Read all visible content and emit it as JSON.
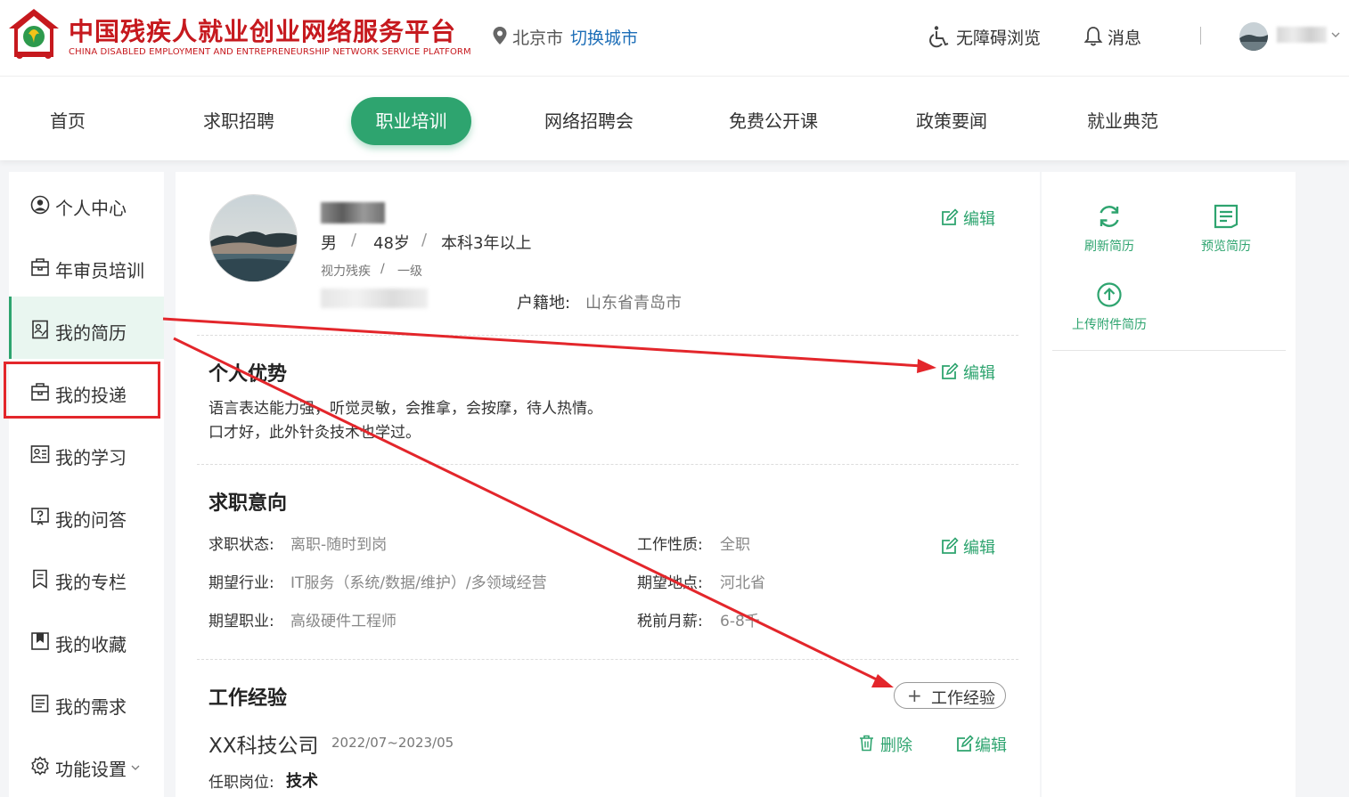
{
  "header": {
    "brand_cn": "中国残疾人就业创业网络服务平台",
    "brand_en": "CHINA DISABLED EMPLOYMENT AND ENTREPRENEURSHIP NETWORK SERVICE PLATFORM",
    "city": "北京市",
    "switch_city": "切换城市",
    "accessibility": "无障碍浏览",
    "messages": "消息",
    "icons": [
      "logo-icon",
      "location-pin-icon",
      "accessibility-icon",
      "bell-icon",
      "chevron-down-icon"
    ]
  },
  "nav": {
    "items": [
      "首页",
      "求职招聘",
      "职业培训",
      "网络招聘会",
      "免费公开课",
      "政策要闻",
      "就业典范"
    ],
    "active": "职业培训"
  },
  "sidebar": {
    "items": [
      {
        "label": "个人中心",
        "icon": "user-circle-icon"
      },
      {
        "label": "年审员培训",
        "icon": "briefcase-icon"
      },
      {
        "label": "我的简历",
        "icon": "resume-icon"
      },
      {
        "label": "我的投递",
        "icon": "briefcase-icon"
      },
      {
        "label": "我的学习",
        "icon": "study-icon"
      },
      {
        "label": "我的问答",
        "icon": "question-icon"
      },
      {
        "label": "我的专栏",
        "icon": "column-icon"
      },
      {
        "label": "我的收藏",
        "icon": "bookmark-icon"
      },
      {
        "label": "我的需求",
        "icon": "list-icon"
      },
      {
        "label": "功能设置",
        "icon": "gear-icon"
      }
    ],
    "active": "我的简历",
    "highlighted": "我的投递"
  },
  "profile": {
    "gender": "男",
    "age": "48岁",
    "experience": "本科3年以上",
    "disability_type": "视力残疾",
    "disability_level": "一级",
    "hukou_label": "户籍地:",
    "hukou_value": "山东省青岛市",
    "edit_label": "编辑"
  },
  "advantages": {
    "title": "个人优势",
    "edit_label": "编辑",
    "lines": [
      "语言表达能力强，听觉灵敏，会推拿，会按摩，待人热情。",
      "口才好，此外针灸技术也学过。"
    ]
  },
  "intention": {
    "title": "求职意向",
    "edit_label": "编辑",
    "fields": [
      {
        "label": "求职状态:",
        "value": "离职-随时到岗"
      },
      {
        "label": "工作性质:",
        "value": "全职"
      },
      {
        "label": "期望行业:",
        "value": "IT服务（系统/数据/维护）/多领域经营"
      },
      {
        "label": "期望地点:",
        "value": "河北省"
      },
      {
        "label": "期望职业:",
        "value": "高级硬件工程师"
      },
      {
        "label": "税前月薪:",
        "value": "6-8千"
      }
    ]
  },
  "experience": {
    "title": "工作经验",
    "add_label": "工作经验",
    "company": "XX科技公司",
    "period": "2022/07~2023/05",
    "delete_label": "删除",
    "edit_label": "编辑",
    "position_label": "任职岗位:",
    "position_value": "技术"
  },
  "right_panel": {
    "refresh": "刷新简历",
    "preview": "预览简历",
    "upload": "上传附件简历"
  },
  "colors": {
    "brand_red": "#c6191e",
    "accent_green": "#2ea46f",
    "link_blue": "#1e6fb8",
    "annotation_red": "#e3262b"
  }
}
